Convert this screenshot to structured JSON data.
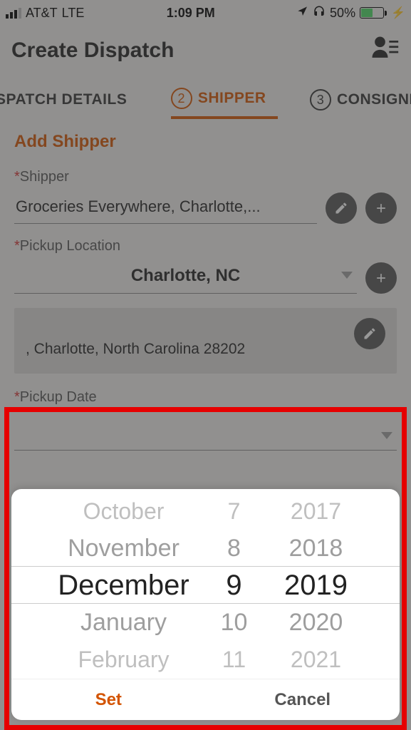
{
  "status": {
    "carrier": "AT&T",
    "network": "LTE",
    "time": "1:09 PM",
    "battery_pct": "50%"
  },
  "header": {
    "title": "Create Dispatch"
  },
  "tabs": {
    "left": {
      "label": "SPATCH DETAILS"
    },
    "active": {
      "num": "2",
      "label": "SHIPPER"
    },
    "right": {
      "num": "3",
      "label": "CONSIGNE"
    }
  },
  "form": {
    "section_title": "Add Shipper",
    "shipper_label": "Shipper",
    "shipper_value": "Groceries Everywhere, Charlotte,...",
    "pickup_location_label": "Pickup Location",
    "pickup_location_value": "Charlotte, NC",
    "address_text": ", Charlotte, North Carolina 28202",
    "pickup_date_label": "Pickup Date"
  },
  "picker": {
    "months": [
      "October",
      "November",
      "December",
      "January",
      "February"
    ],
    "days": [
      "7",
      "8",
      "9",
      "10",
      "11"
    ],
    "years": [
      "2017",
      "2018",
      "2019",
      "2020",
      "2021"
    ],
    "set_label": "Set",
    "cancel_label": "Cancel"
  }
}
